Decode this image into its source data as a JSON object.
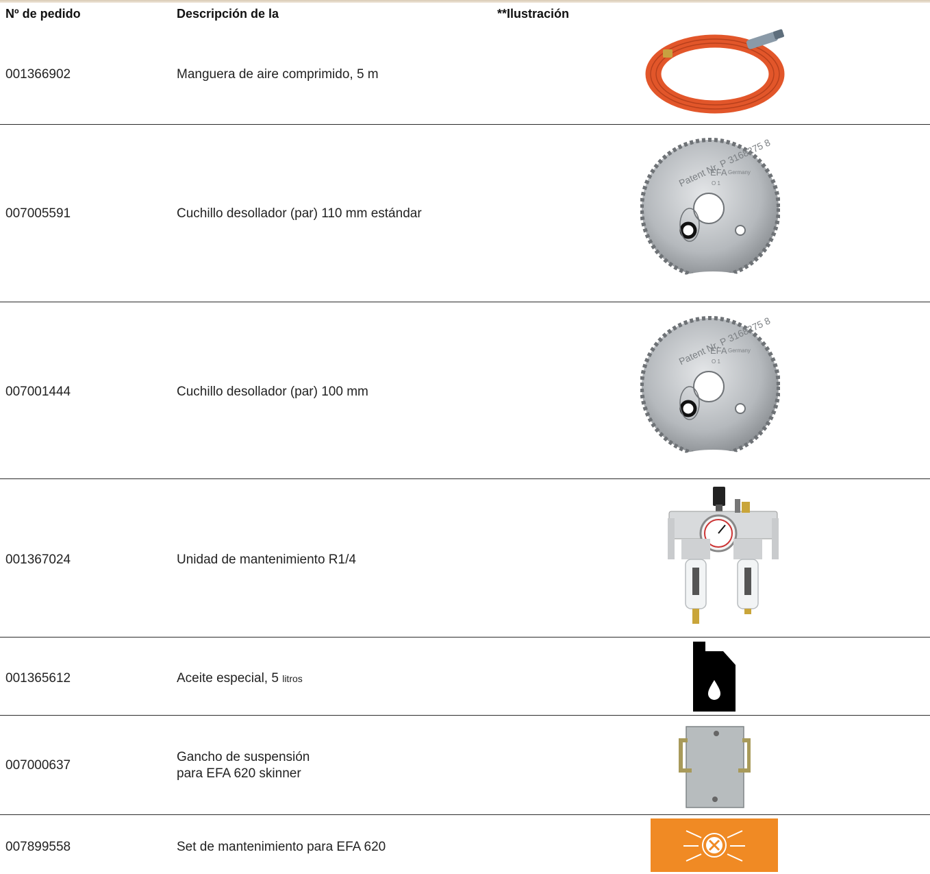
{
  "header": {
    "col_order": "Nº de pedido",
    "col_desc": "Descripción de la",
    "col_image": "**Ilustración"
  },
  "rows": [
    {
      "order": "001366902",
      "desc": "Manguera de aire comprimido, 5 m",
      "image": "hose-image"
    },
    {
      "order": "007005591",
      "desc": "Cuchillo desollador (par) 110 mm estándar",
      "image": "blade-image",
      "blade_text": {
        "patent": "Patent Nr. P 3168275 8",
        "brand": "EFA",
        "country": "Germany",
        "mark": "O 1"
      }
    },
    {
      "order": "007001444",
      "desc": "Cuchillo desollador (par) 100 mm",
      "image": "blade-image",
      "blade_text": {
        "patent": "Patent Nr. P 3168275 8",
        "brand": "EFA",
        "country": "Germany",
        "mark": "O 1"
      }
    },
    {
      "order": "001367024",
      "desc": "Unidad de mantenimiento R1/4",
      "image": "maintenance-unit-image"
    },
    {
      "order": "001365612",
      "desc_main": "Aceite especial, 5",
      "desc_small": "litros",
      "image": "oil-can-icon"
    },
    {
      "order": "007000637",
      "desc_line1": "Gancho de suspensión",
      "desc_line2": "para EFA 620 skinner",
      "image": "hook-image"
    },
    {
      "order": "007899558",
      "desc": "Set de mantenimiento para EFA 620",
      "image": "maintenance-set-icon"
    }
  ],
  "colors": {
    "accent_orange": "#f08a24",
    "hose_orange": "#e2562a",
    "rule": "#2a2a2a"
  }
}
